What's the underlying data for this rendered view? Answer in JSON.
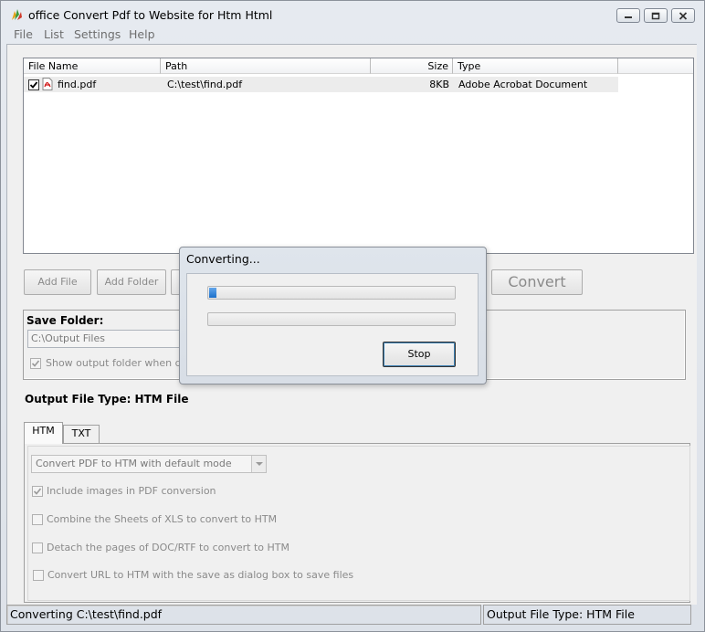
{
  "window": {
    "title": "office Convert Pdf to Website for Htm Html"
  },
  "menu": [
    "File",
    "List",
    "Settings",
    "Help"
  ],
  "file_list": {
    "columns": [
      "File Name",
      "Path",
      "Size",
      "Type"
    ],
    "rows": [
      {
        "checked": true,
        "name": "find.pdf",
        "path": "C:\\test\\find.pdf",
        "size": "8KB",
        "type": "Adobe Acrobat Document"
      }
    ]
  },
  "buttons": {
    "add_file": "Add File",
    "add_folder": "Add Folder",
    "convert": "Convert"
  },
  "save_folder": {
    "label": "Save Folder:",
    "value": "C:\\Output Files",
    "show_output_label": "Show output folder when done",
    "show_output_checked": true
  },
  "output_type": {
    "label": "Output File Type:  HTM File"
  },
  "tabs": [
    "HTM",
    "TXT"
  ],
  "htm_options": {
    "mode_select": "Convert PDF to HTM with default mode",
    "checkboxes": [
      {
        "label": "Include images in PDF conversion",
        "checked": true
      },
      {
        "label": "Combine the Sheets of XLS to convert to HTM",
        "checked": false
      },
      {
        "label": "Detach the pages of DOC/RTF to convert to HTM",
        "checked": false
      },
      {
        "label": "Convert URL to HTM with the save as dialog box to save files",
        "checked": false
      }
    ]
  },
  "status": {
    "left": "Converting  C:\\test\\find.pdf",
    "right": "Output File Type:  HTM File"
  },
  "dialog": {
    "title": "Converting...",
    "progress_1": 0.03,
    "progress_2": 0,
    "stop": "Stop"
  },
  "colors": {
    "progress_fill": "#1b6fc9",
    "disabled_text": "#8a8a8a"
  }
}
